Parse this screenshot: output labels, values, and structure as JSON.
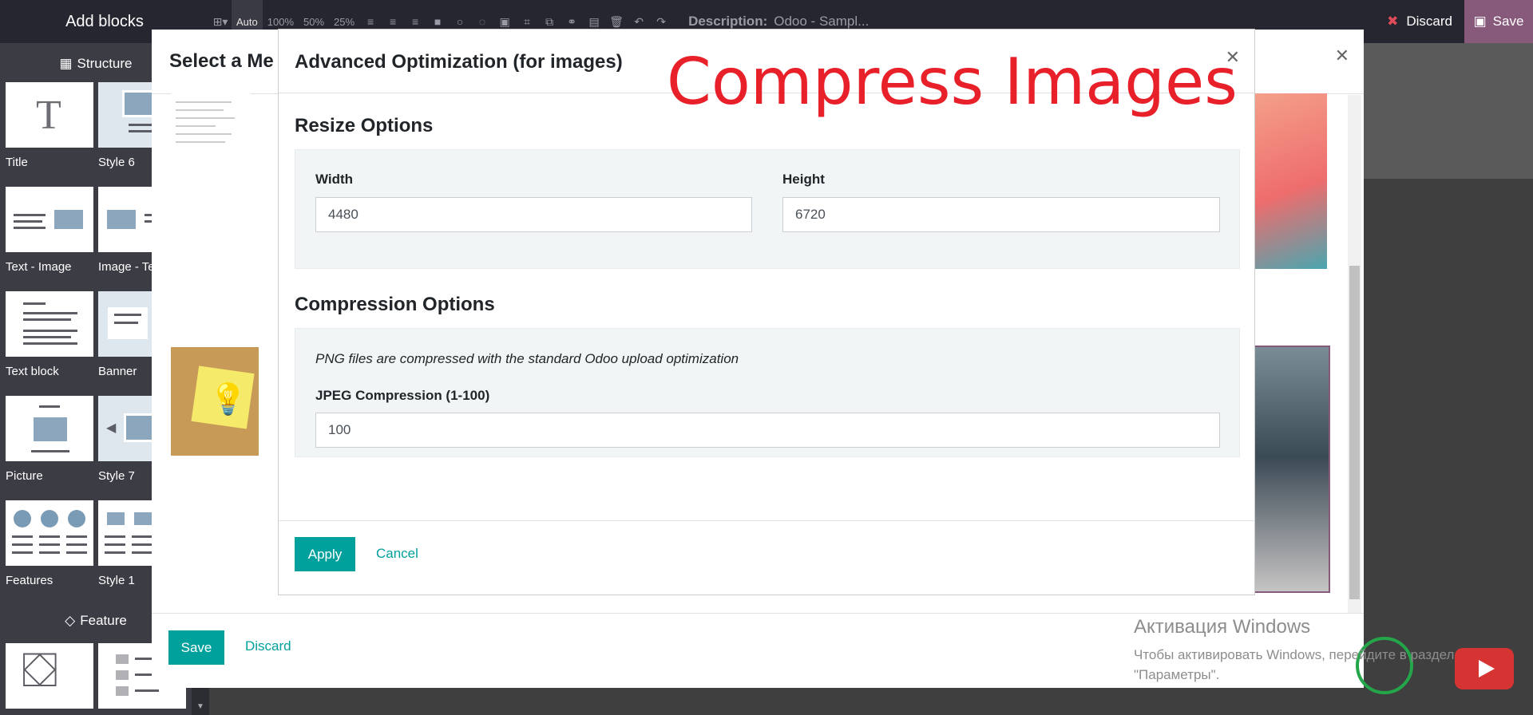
{
  "topbar": {
    "title": "Add blocks",
    "zoom": [
      "Auto",
      "100%",
      "50%",
      "25%"
    ],
    "description_label": "Description:",
    "description_value": "Odoo - Sampl...",
    "discard_label": "Discard",
    "save_label": "Save"
  },
  "sidebar": {
    "structure_title": "Structure",
    "feature_title": "Feature",
    "blocks": [
      "Title",
      "Style 6",
      "Text - Image",
      "Image - Te",
      "Text block",
      "Banner",
      "Picture",
      "Style 7",
      "Features",
      "Style 1"
    ]
  },
  "media_dialog": {
    "title": "Select a Me",
    "save_label": "Save",
    "discard_label": "Discard"
  },
  "optimization_dialog": {
    "title": "Advanced Optimization (for images)",
    "overlay_caption": "Compress Images",
    "resize_title": "Resize Options",
    "width_label": "Width",
    "width_value": "4480",
    "height_label": "Height",
    "height_value": "6720",
    "compression_title": "Compression Options",
    "png_note": "PNG files are compressed with the standard Odoo upload optimization",
    "jpeg_label": "JPEG Compression (1-100)",
    "jpeg_value": "100",
    "apply_label": "Apply",
    "cancel_label": "Cancel"
  },
  "windows_activation": {
    "title": "Активация Windows",
    "line1": "Чтобы активировать Windows, перейдите в раздел",
    "line2": "\"Параметры\"."
  },
  "colors": {
    "accent": "#00a09d",
    "brand": "#875a7b",
    "caption": "#e8202a"
  }
}
